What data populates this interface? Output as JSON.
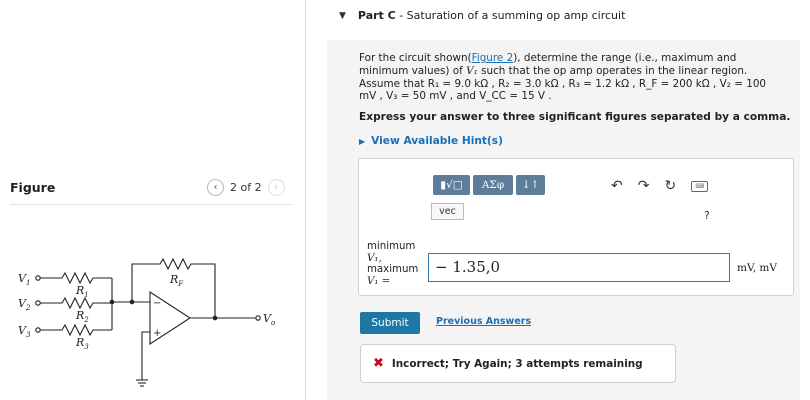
{
  "figure": {
    "title": "Figure",
    "pager": "2 of 2",
    "prev_icon": "chevron-left-icon",
    "next_icon": "chevron-right-icon",
    "labels": {
      "v1": "V",
      "v1_sub": "1",
      "v2": "V",
      "v2_sub": "2",
      "v3": "V",
      "v3_sub": "3",
      "r1": "R",
      "r1_sub": "1",
      "r2": "R",
      "r2_sub": "2",
      "r3": "R",
      "r3_sub": "3",
      "rf": "R",
      "rf_sub": "F",
      "vo": "V",
      "vo_sub": "o",
      "minus": "−",
      "plus": "+"
    }
  },
  "part": {
    "caret_icon": "caret-down-icon",
    "label": "Part C",
    "title": " - Saturation of a summing op amp circuit"
  },
  "prompt": {
    "intro": "For the circuit shown(",
    "link": "Figure 2",
    "line1_rest": "), determine the range (i.e., maximum and",
    "line2": "minimum values) of ",
    "v1": "V₁",
    "line2_rest": " such that the op amp operates in the linear region.",
    "line3": "Assume that R₁ = 9.0 kΩ , R₂ = 3.0 kΩ , R₃ = 1.2 kΩ , R_F = 200 kΩ , V₂ = 100",
    "line4": "mV , V₃ = 50 mV , and V_CC = 15 V ."
  },
  "express": "Express your answer to three significant figures separated by a comma.",
  "hints": "View Available Hint(s)",
  "toolbar": {
    "b1": "▮√□",
    "b2": "ΑΣφ",
    "b3": "↓↑",
    "vec": "vec",
    "undo_icon": "undo-icon",
    "redo_icon": "redo-icon",
    "reset_icon": "reset-icon",
    "keyboard_icon": "keyboard-icon",
    "help": "?"
  },
  "answer": {
    "label_min": "minimum",
    "label_v1a": "V₁,",
    "label_max": "maximum",
    "label_v1b": "V₁ =",
    "value": "− 1.35,0",
    "unit": "mV, mV"
  },
  "actions": {
    "submit": "Submit",
    "previous": "Previous Answers"
  },
  "feedback": {
    "icon": "x-icon",
    "text": "Incorrect; Try Again; 3 attempts remaining"
  }
}
